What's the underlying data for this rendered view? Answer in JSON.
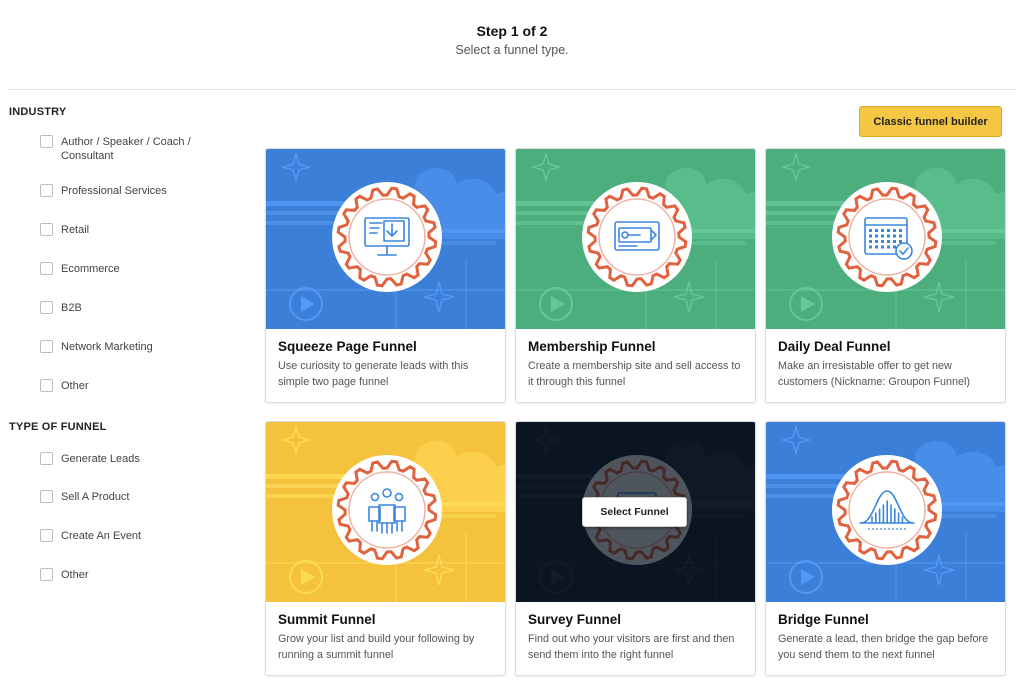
{
  "header": {
    "title": "Step 1 of 2",
    "subtitle": "Select a funnel type."
  },
  "sidebar": {
    "industry": {
      "title": "INDUSTRY",
      "items": [
        {
          "label": "Author / Speaker / Coach / Consultant"
        },
        {
          "label": "Professional Services"
        },
        {
          "label": "Retail"
        },
        {
          "label": "Ecommerce"
        },
        {
          "label": "B2B"
        },
        {
          "label": "Network Marketing"
        },
        {
          "label": "Other"
        }
      ]
    },
    "funnel_type": {
      "title": "TYPE OF FUNNEL",
      "items": [
        {
          "label": "Generate Leads"
        },
        {
          "label": "Sell A Product"
        },
        {
          "label": "Create An Event"
        },
        {
          "label": "Other"
        }
      ]
    }
  },
  "toolbar": {
    "classic_label": "Classic funnel builder"
  },
  "colors": {
    "blue": "#3b7fd9",
    "green": "#4cae7d",
    "yellow": "#f5c23e",
    "dark": "#0d1b2a",
    "gear": "#e0623f",
    "icon": "#3a86e0",
    "button_yellow": "#f5c643"
  },
  "cards": [
    {
      "title": "Squeeze Page Funnel",
      "description": "Use curiosity to generate leads with this simple two page funnel",
      "theme": "blue",
      "icon": "monitor-download-icon"
    },
    {
      "title": "Membership Funnel",
      "description": "Create a membership site and sell access to it through this funnel",
      "theme": "green",
      "icon": "membership-card-icon"
    },
    {
      "title": "Daily Deal Funnel",
      "description": "Make an irresistable offer to get new customers (Nickname: Groupon Funnel)",
      "theme": "green",
      "icon": "calendar-check-icon"
    },
    {
      "title": "Summit Funnel",
      "description": "Grow your list and build your following by running a summit funnel",
      "theme": "yellow",
      "icon": "people-group-icon"
    },
    {
      "title": "Survey Funnel",
      "description": "Find out who your visitors are first and then send them into the right funnel",
      "theme": "dark",
      "icon": "survey-icon",
      "hover_label": "Select Funnel"
    },
    {
      "title": "Bridge Funnel",
      "description": "Generate a lead, then bridge the gap before you send them to the next funnel",
      "theme": "blue",
      "icon": "bridge-icon"
    }
  ]
}
